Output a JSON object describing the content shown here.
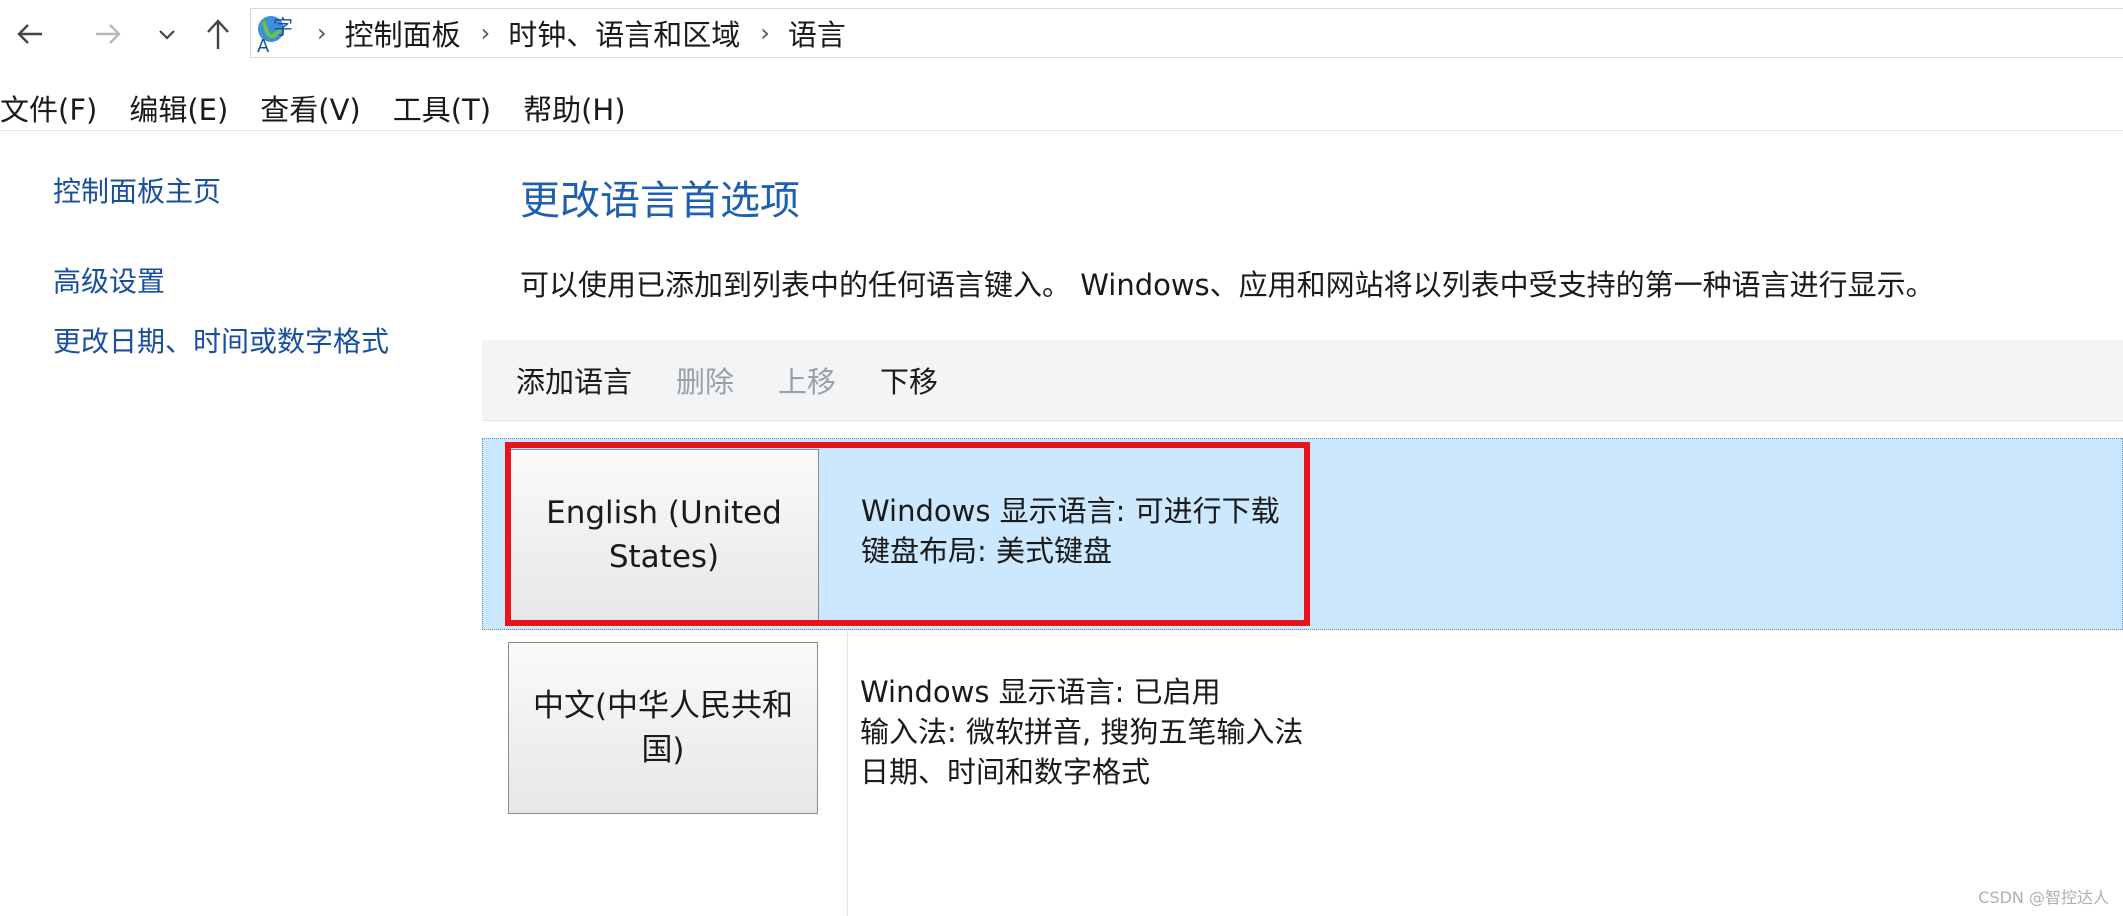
{
  "nav": {
    "back_icon": "arrow-left-icon",
    "forward_icon": "arrow-right-icon",
    "recent_icon": "chevron-down-icon",
    "up_icon": "arrow-up-icon"
  },
  "address": {
    "location_icon": "language-globe-icon",
    "crumbs": [
      "控制面板",
      "时钟、语言和区域",
      "语言"
    ]
  },
  "menu": [
    "文件(F)",
    "编辑(E)",
    "查看(V)",
    "工具(T)",
    "帮助(H)"
  ],
  "sidebar": {
    "home": "控制面板主页",
    "advanced": "高级设置",
    "date_format": "更改日期、时间或数字格式"
  },
  "main": {
    "title": "更改语言首选项",
    "description": "可以使用已添加到列表中的任何语言键入。 Windows、应用和网站将以列表中受支持的第一种语言进行显示。",
    "toolbar": {
      "add": "添加语言",
      "remove": "删除",
      "move_up": "上移",
      "move_down": "下移"
    },
    "languages": [
      {
        "name": "English (United States)",
        "details": [
          "Windows 显示语言: 可进行下载",
          "键盘布局: 美式键盘"
        ],
        "selected": true
      },
      {
        "name": "中文(中华人民共和国)",
        "details": [
          "Windows 显示语言: 已启用",
          "输入法: 微软拼音, 搜狗五笔输入法",
          "日期、时间和数字格式"
        ],
        "selected": false
      }
    ]
  },
  "colors": {
    "link": "#1a4fa0",
    "title": "#1e5fb0",
    "selection": "#cce8ff",
    "highlight": "#e8141a"
  },
  "watermark": "CSDN @智控达人"
}
